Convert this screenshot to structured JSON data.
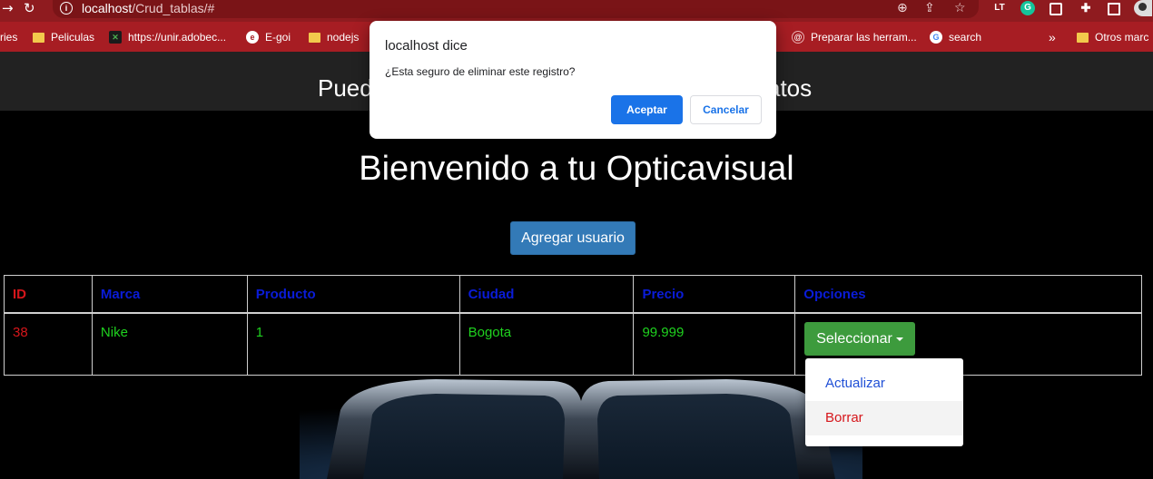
{
  "browser": {
    "url_host": "localhost",
    "url_path": "/Crud_tablas/#",
    "bookmarks": [
      {
        "label": "ries",
        "icon": "none"
      },
      {
        "label": "Peliculas",
        "icon": "folder-icon"
      },
      {
        "label": "https://unir.adobec...",
        "icon": "adobe-connect-icon"
      },
      {
        "label": "E-goi",
        "icon": "egoi-icon"
      },
      {
        "label": "nodejs",
        "icon": "folder-icon"
      },
      {
        "label": "Preparar las herram...",
        "icon": "at-icon"
      },
      {
        "label": "search",
        "icon": "google-icon"
      },
      {
        "label": "»",
        "icon": "none"
      },
      {
        "label": "Otros marc",
        "icon": "folder-icon"
      }
    ]
  },
  "page": {
    "navbar_left": "Pued",
    "navbar_right": "atos",
    "welcome": "Bienvenido a tu Opticavisual",
    "add_button": "Agregar usuario"
  },
  "table": {
    "headers": [
      "ID",
      "Marca",
      "Producto",
      "Ciudad",
      "Precio",
      "Opciones"
    ],
    "rows": [
      {
        "id": "38",
        "marca": "Nike",
        "producto": "1",
        "ciudad": "Bogota",
        "precio": "99.999"
      }
    ]
  },
  "options_menu": {
    "button": "Seleccionar",
    "items": [
      "Actualizar",
      "Borrar"
    ]
  },
  "dialog": {
    "title": "localhost dice",
    "message": "¿Esta seguro de eliminar este registro?",
    "ok": "Aceptar",
    "cancel": "Cancelar"
  },
  "colors": {
    "chrome_bar": "#8f1b1f",
    "bookmarks_bar": "#a71d23",
    "header_text": "#0a1cd8",
    "id_text": "#d6161b",
    "cell_text": "#1fd21f",
    "primary_button": "#337ab7",
    "success_button": "#3d9b3d",
    "dialog_accent": "#1a73e8"
  }
}
